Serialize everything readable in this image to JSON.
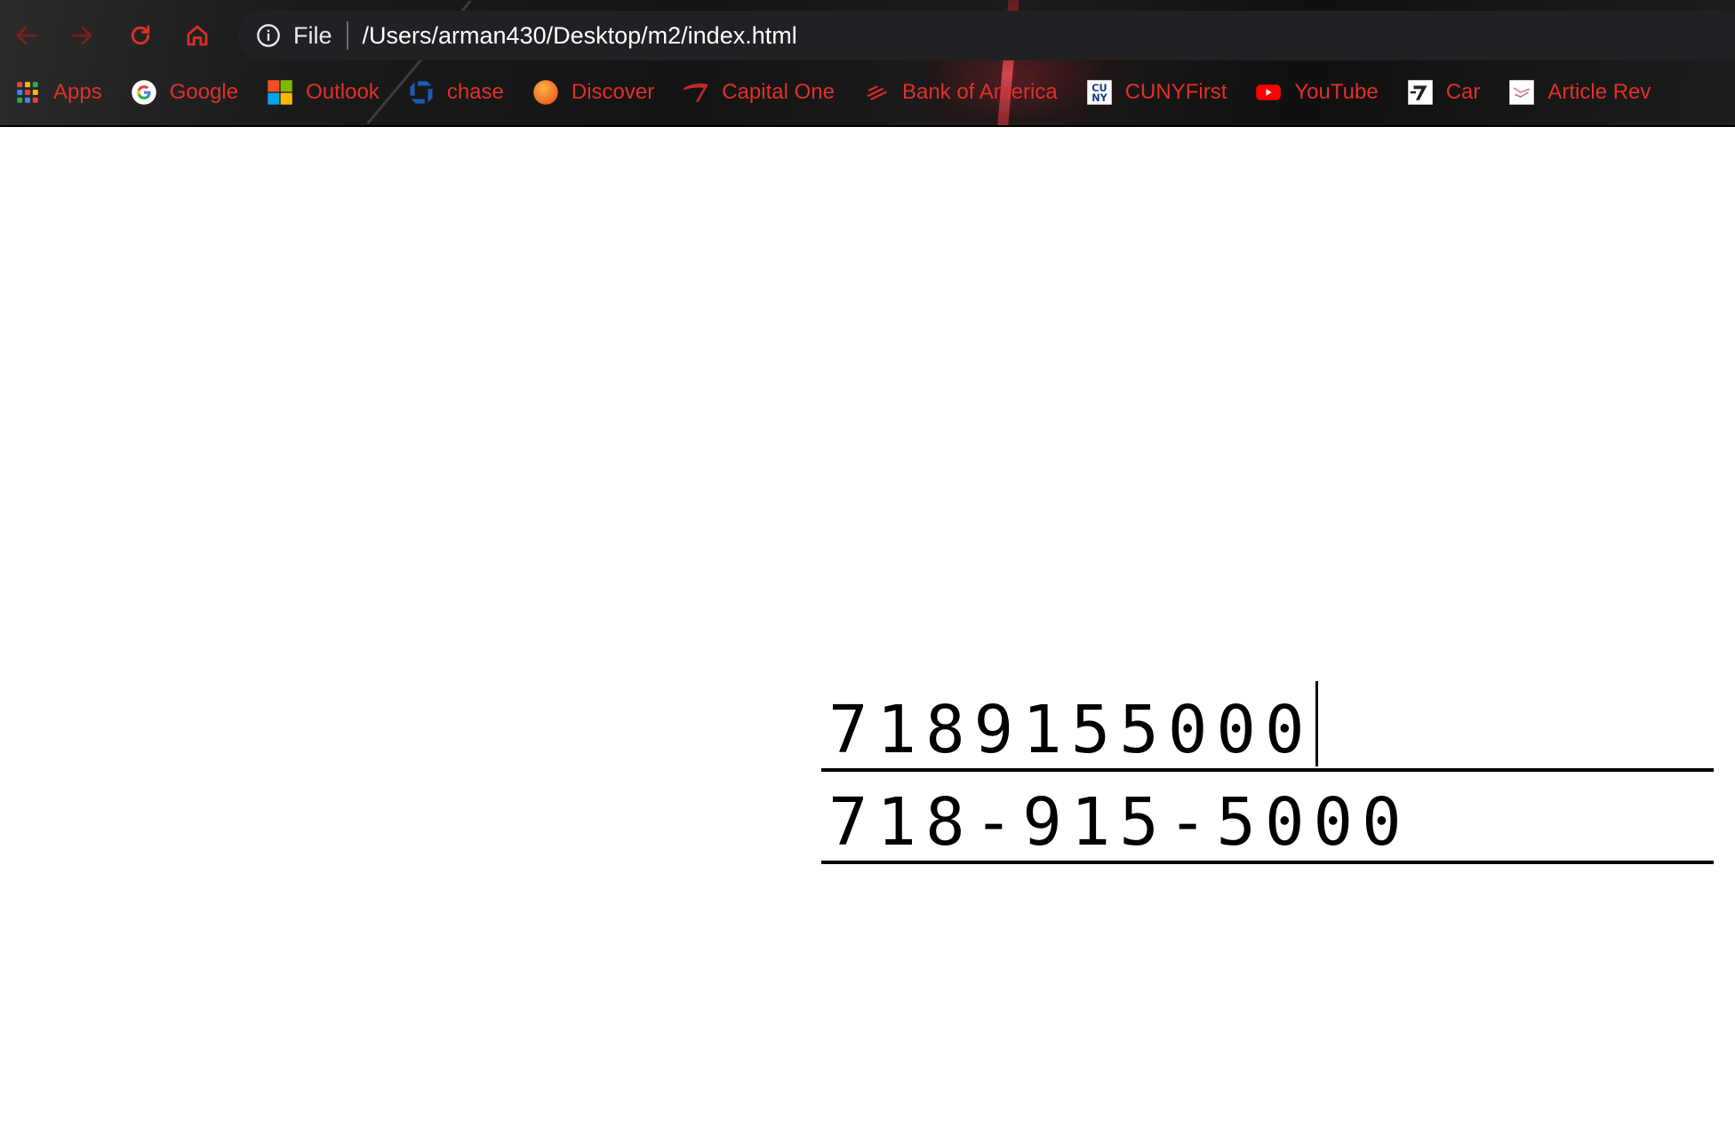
{
  "browser": {
    "address": {
      "scheme_label": "File",
      "url": "/Users/arman430/Desktop/m2/index.html"
    },
    "bookmarks": [
      {
        "label": "Apps",
        "icon": "apps-grid-icon"
      },
      {
        "label": "Google",
        "icon": "google-icon"
      },
      {
        "label": "Outlook",
        "icon": "microsoft-icon"
      },
      {
        "label": "chase",
        "icon": "chase-icon"
      },
      {
        "label": "Discover",
        "icon": "discover-icon"
      },
      {
        "label": "Capital One",
        "icon": "capital-one-icon"
      },
      {
        "label": "Bank of America",
        "icon": "bank-of-america-icon"
      },
      {
        "label": "CUNYFirst",
        "icon": "cuny-icon"
      },
      {
        "label": "YouTube",
        "icon": "youtube-icon"
      },
      {
        "label": "Car",
        "icon": "car-site-icon"
      },
      {
        "label": "Article Rev",
        "icon": "article-icon"
      }
    ],
    "colors": {
      "bookmark_text": "#e0302a",
      "nav_icons": "#d93025"
    }
  },
  "page": {
    "phone_input": "7189155000",
    "phone_formatted": "718-915-5000"
  }
}
